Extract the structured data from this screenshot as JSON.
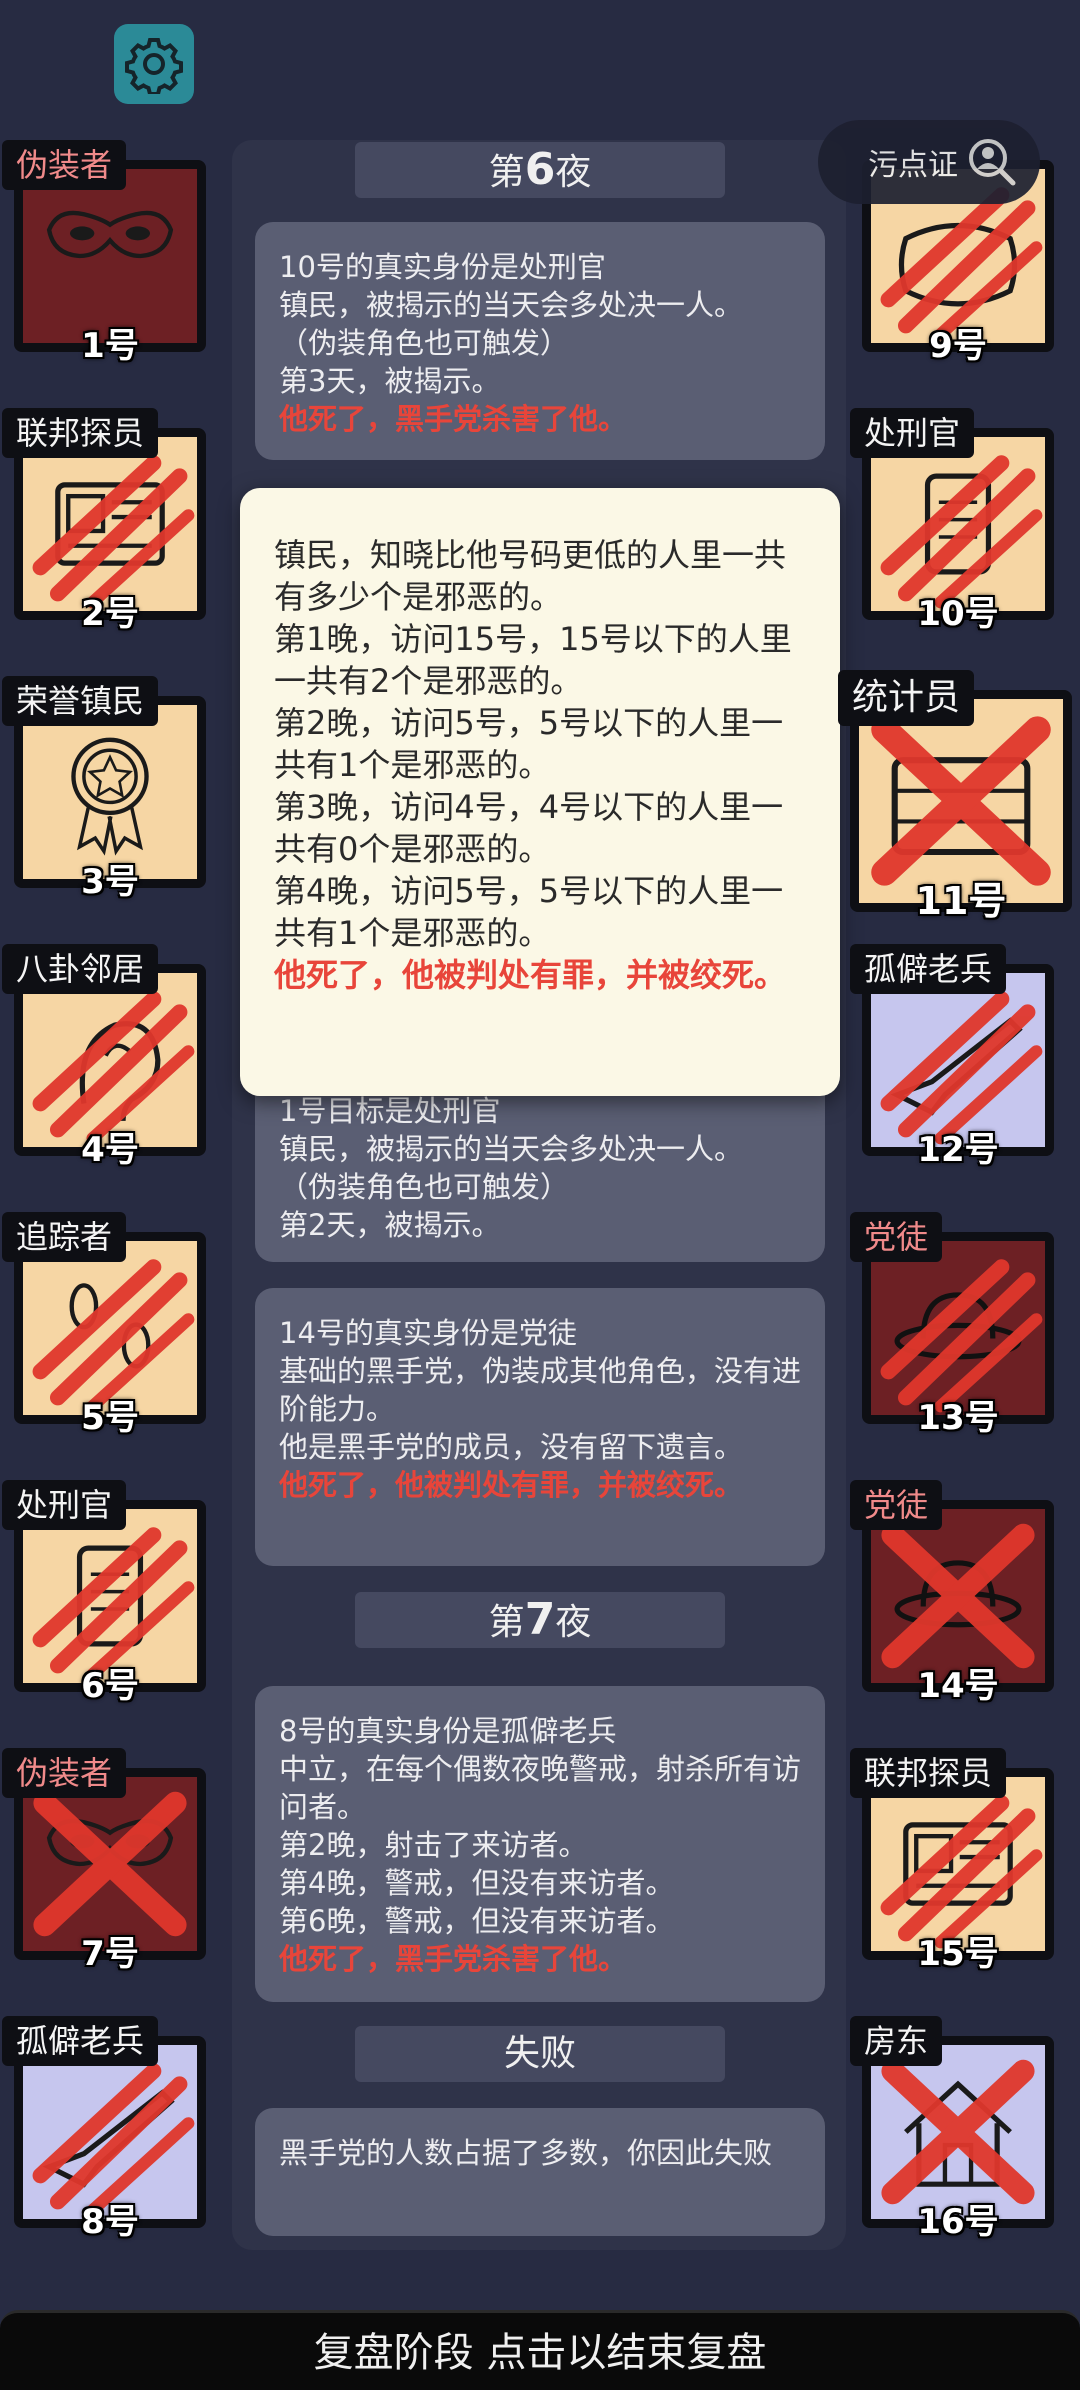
{
  "settings": {
    "icon": "gear-icon"
  },
  "notes_toggle": {
    "label": "污点证"
  },
  "left_players": [
    {
      "role": "伪装者",
      "number": "1号",
      "evil": true,
      "bg": "#6d2024",
      "art": "mask",
      "status": "alive"
    },
    {
      "role": "联邦探员",
      "number": "2号",
      "evil": false,
      "bg": "#f6d6a4",
      "art": "badge",
      "status": "clawed"
    },
    {
      "role": "荣誉镇民",
      "number": "3号",
      "evil": false,
      "bg": "#f6d6a4",
      "art": "medal",
      "status": "alive"
    },
    {
      "role": "八卦邻居",
      "number": "4号",
      "evil": false,
      "bg": "#f6d6a4",
      "art": "ear",
      "status": "clawed"
    },
    {
      "role": "追踪者",
      "number": "5号",
      "evil": false,
      "bg": "#f6d6a4",
      "art": "footprints",
      "status": "clawed"
    },
    {
      "role": "处刑官",
      "number": "6号",
      "evil": false,
      "bg": "#f6d6a4",
      "art": "scroll",
      "status": "clawed"
    },
    {
      "role": "伪装者",
      "number": "7号",
      "evil": true,
      "bg": "#6d2024",
      "art": "mask",
      "status": "crossed"
    },
    {
      "role": "孤僻老兵",
      "number": "8号",
      "evil": false,
      "bg": "#c6c6ee",
      "art": "rifle",
      "status": "clawed"
    }
  ],
  "right_players": [
    {
      "role": "",
      "number": "9号",
      "evil": false,
      "bg": "#f6d6a4",
      "art": "pillow",
      "status": "clawed"
    },
    {
      "role": "处刑官",
      "number": "10号",
      "evil": false,
      "bg": "#f6d6a4",
      "art": "scroll",
      "status": "clawed"
    },
    {
      "role": "统计员",
      "number": "11号",
      "evil": false,
      "bg": "#f6d6a4",
      "art": "abacus",
      "status": "crossed"
    },
    {
      "role": "孤僻老兵",
      "number": "12号",
      "evil": false,
      "bg": "#c6c6ee",
      "art": "rifle",
      "status": "clawed"
    },
    {
      "role": "党徒",
      "number": "13号",
      "evil": true,
      "bg": "#6d2024",
      "art": "hat",
      "status": "clawed"
    },
    {
      "role": "党徒",
      "number": "14号",
      "evil": true,
      "bg": "#6d2024",
      "art": "hat",
      "status": "crossed"
    },
    {
      "role": "联邦探员",
      "number": "15号",
      "evil": false,
      "bg": "#f6d6a4",
      "art": "badge",
      "status": "clawed"
    },
    {
      "role": "房东",
      "number": "16号",
      "evil": false,
      "bg": "#c6c6ee",
      "art": "house",
      "status": "crossed"
    }
  ],
  "log": {
    "night6_header": {
      "prefix": "第",
      "num": "6",
      "suffix": "夜"
    },
    "entry_a": {
      "lines": [
        "10号的真实身份是处刑官",
        "镇民，被揭示的当天会多处决一人。",
        "（伪装角色也可触发）",
        "第3天，被揭示。"
      ],
      "death": "他死了，黑手党杀害了他。"
    },
    "entry_b": {
      "lines": [
        "1号目标是处刑官",
        "镇民，被揭示的当天会多处决一人。",
        "（伪装角色也可触发）",
        "第2天，被揭示。"
      ]
    },
    "entry_c": {
      "lines": [
        "14号的真实身份是党徒",
        "基础的黑手党，伪装成其他角色，没有进阶能力。",
        "他是黑手党的成员，没有留下遗言。"
      ],
      "death": "他死了，他被判处有罪，并被绞死。"
    },
    "night7_header": {
      "prefix": "第",
      "num": "7",
      "suffix": "夜"
    },
    "entry_d": {
      "lines": [
        "8号的真实身份是孤僻老兵",
        "中立，在每个偶数夜晚警戒，射杀所有访问者。",
        "第2晚，射击了来访者。",
        "第4晚，警戒，但没有来访者。",
        "第6晚，警戒，但没有来访者。"
      ],
      "death": "他死了，黑手党杀害了他。"
    },
    "defeat_header": "失败",
    "entry_e": {
      "lines": [
        "黑手党的人数占据了多数，你因此失败"
      ]
    }
  },
  "popup": {
    "lines": [
      "镇民，知晓比他号码更低的人里一共有多少个是邪恶的。",
      "第1晚，访问15号，15号以下的人里一共有2个是邪恶的。",
      "第2晚，访问5号，5号以下的人里一共有1个是邪恶的。",
      "第3晚，访问4号，4号以下的人里一共有0个是邪恶的。",
      "第4晚，访问5号，5号以下的人里一共有1个是邪恶的。"
    ],
    "death": "他死了，他被判处有罪，并被绞死。"
  },
  "bottom_bar": {
    "label": "复盘阶段 点击以结束复盘"
  },
  "colors": {
    "background": "#272b42",
    "death_text": "#e8453a",
    "evil_role": "#f08a8a",
    "claw": "#e0372c"
  }
}
